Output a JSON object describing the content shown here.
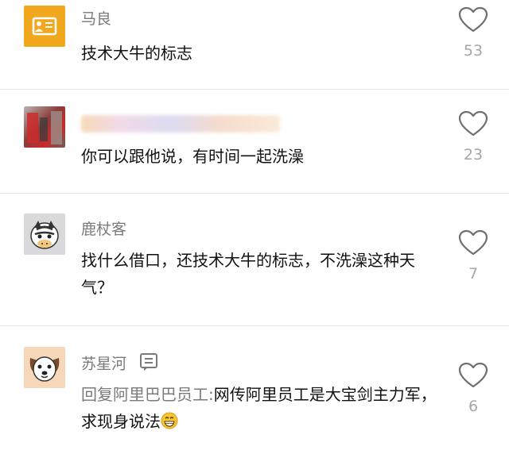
{
  "comments": [
    {
      "name": "马良",
      "text": "技术大牛的标志",
      "likes": "53",
      "avatar_icon": "id-card-icon",
      "avatar_color": "#f2a81e"
    },
    {
      "name": "",
      "text": "你可以跟他说，有时间一起洗澡",
      "likes": "23",
      "avatar_icon": "photo-avatar",
      "name_blurred": true
    },
    {
      "name": "鹿杖客",
      "text": "找什么借口，还技术大牛的标志，不洗澡这种天气？",
      "likes": "7",
      "avatar_icon": "zebra-face-icon"
    },
    {
      "name": "苏星河",
      "reply_prefix": "回复阿里巴巴员工:",
      "text": "网传阿里员工是大宝剑主力军，求现身说法",
      "likes": "6",
      "avatar_icon": "dog-face-icon",
      "badge_icon": "reply-list-icon"
    }
  ],
  "colors": {
    "name": "#7a7a7a",
    "text": "#111111",
    "likes": "#a6a6a6",
    "divider": "#e6e6e6"
  }
}
